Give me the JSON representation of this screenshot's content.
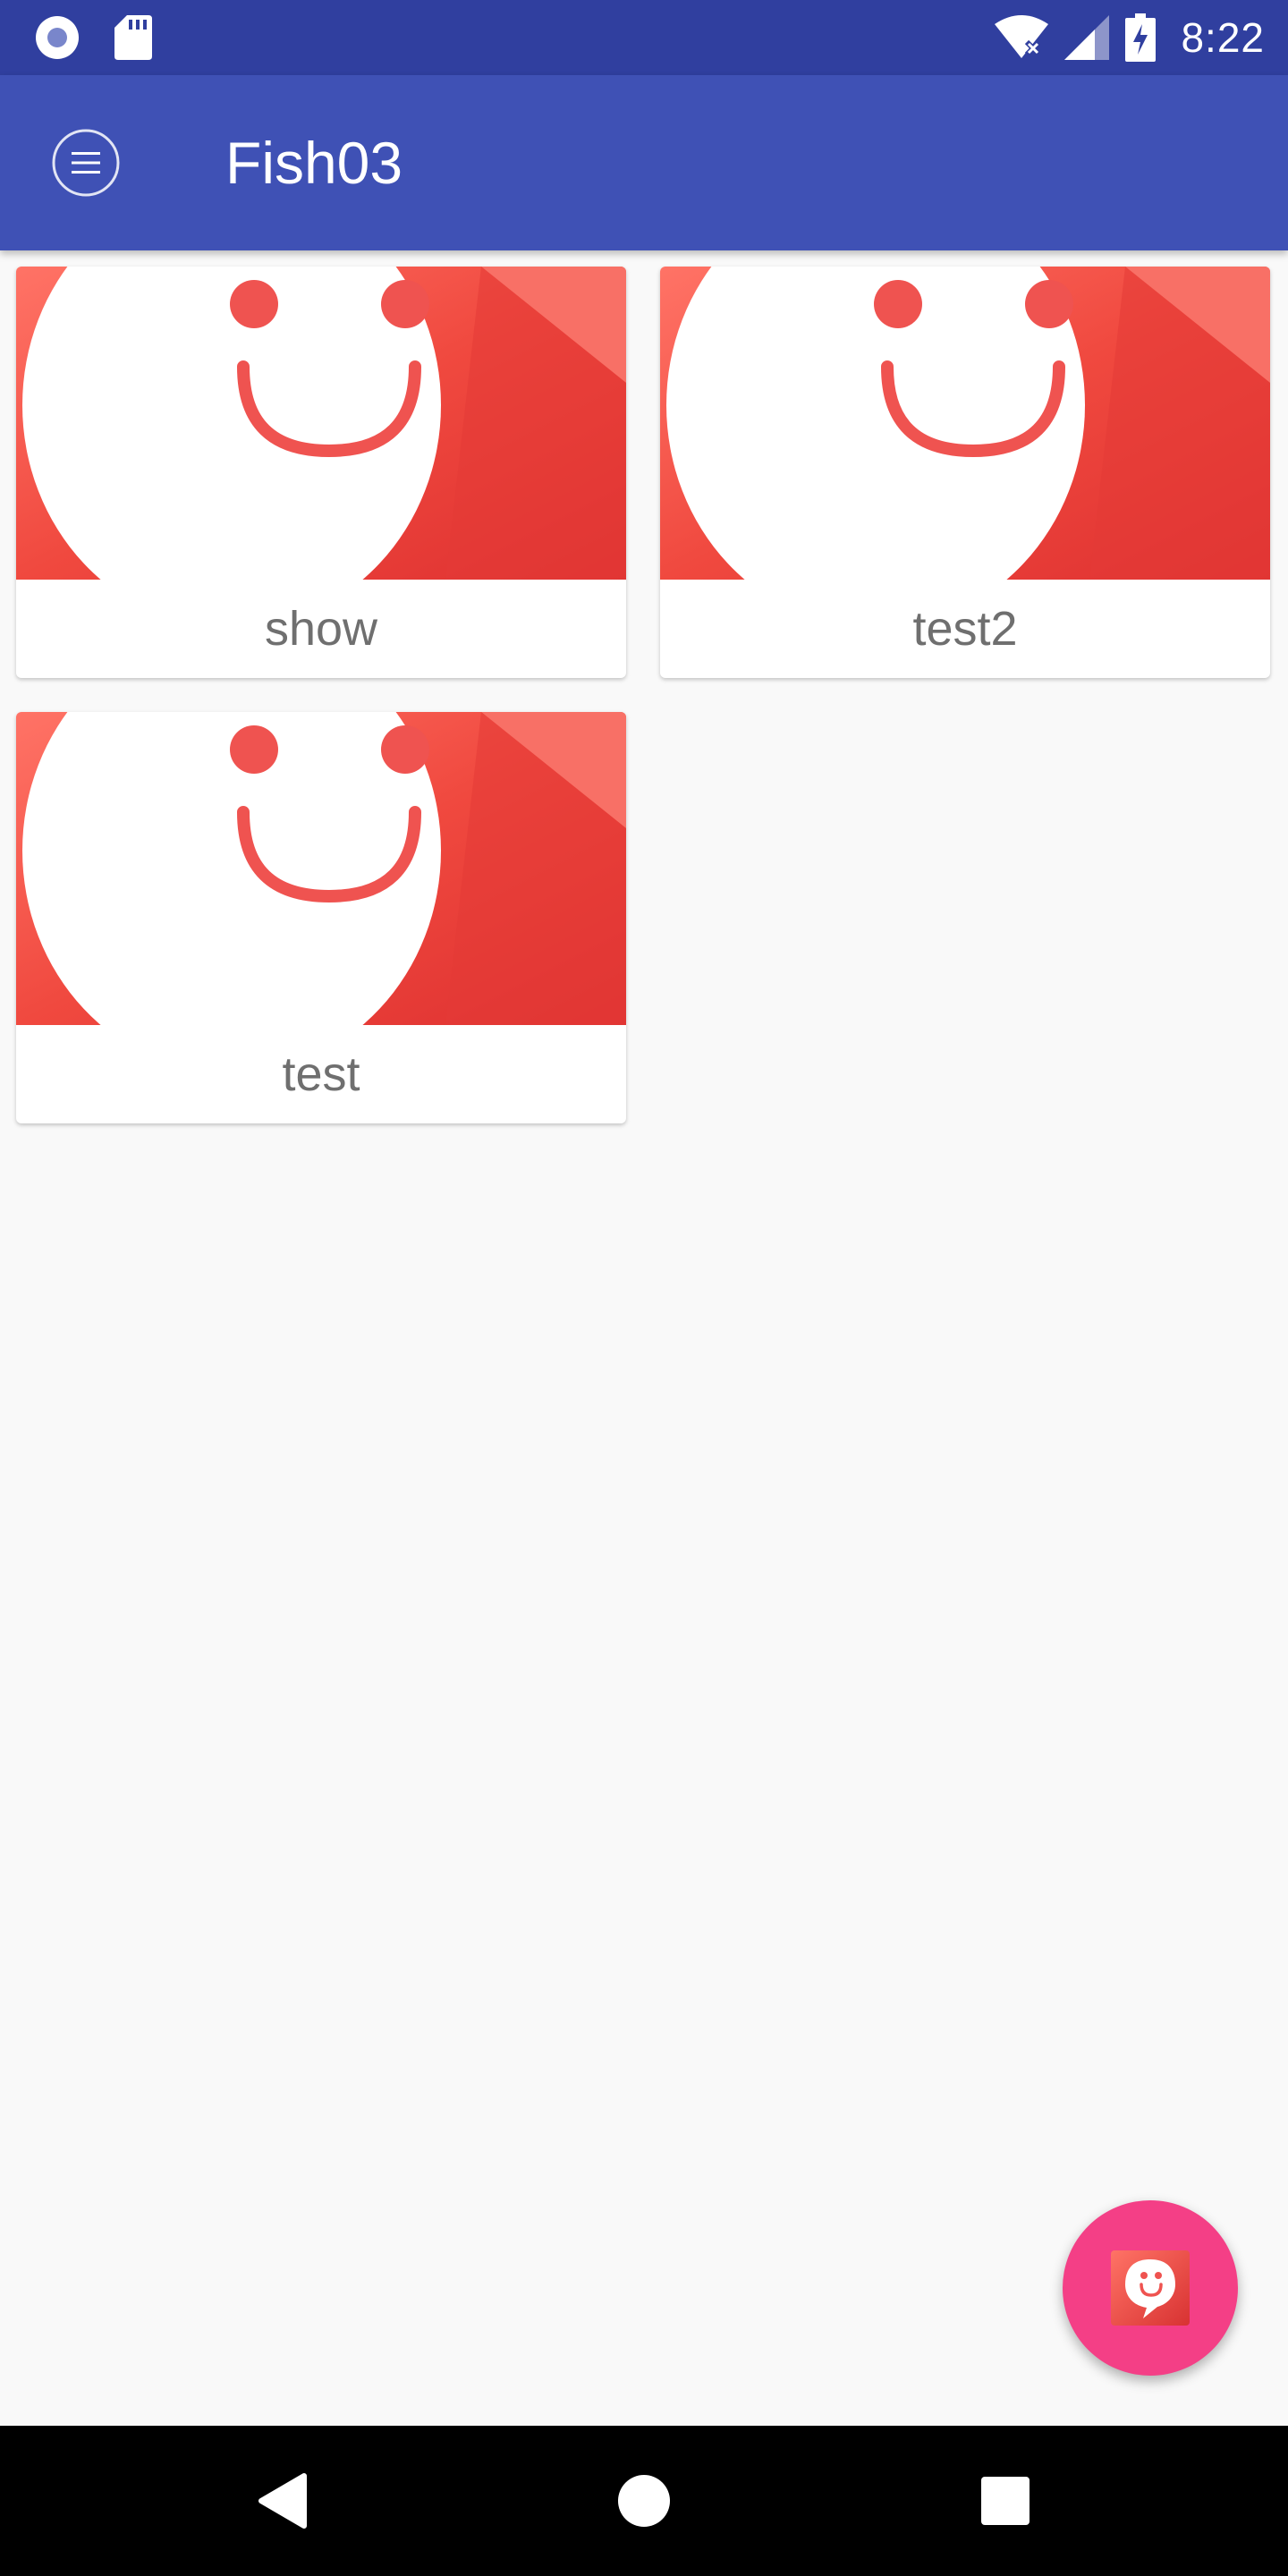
{
  "status_bar": {
    "time": "8:22",
    "icons": [
      "record-icon",
      "sd-card-icon",
      "wifi-off-icon",
      "cell-signal-icon",
      "battery-charging-icon"
    ]
  },
  "app_bar": {
    "title": "Fish03",
    "menu_icon": "menu-icon",
    "color": "#3f51b5"
  },
  "items": [
    {
      "label": "show",
      "icon": "smiley-thumbnail"
    },
    {
      "label": "test2",
      "icon": "smiley-thumbnail"
    },
    {
      "label": "test",
      "icon": "smiley-thumbnail"
    }
  ],
  "fab": {
    "icon": "chat-smiley-icon",
    "color": "#f43f86"
  },
  "nav_bar": {
    "back": "back-icon",
    "home": "home-icon",
    "recents": "recents-icon"
  },
  "colors": {
    "status_bar": "#303f9f",
    "thumbnail_red": "#e53935",
    "background": "#f9f9f9"
  }
}
